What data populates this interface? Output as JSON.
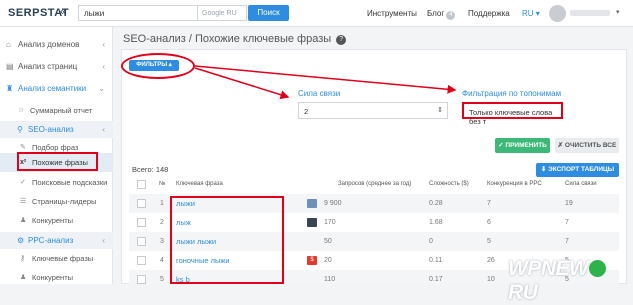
{
  "header": {
    "logo": "SERPSTAT",
    "collapse_glyph": "«",
    "search_value": "лыжи",
    "region": "Google RU",
    "search_button": "Поиск",
    "nav": [
      {
        "label": "Инструменты"
      },
      {
        "label": "Блог",
        "badge": "4"
      },
      {
        "label": "Поддержка"
      }
    ],
    "lang": "RU",
    "caret": "▾"
  },
  "sidebar": {
    "items": [
      {
        "label": "Анализ доменов",
        "icon": "⌂"
      },
      {
        "label": "Анализ страниц",
        "icon": "▤"
      },
      {
        "label": "Анализ семантики",
        "icon": "♜"
      }
    ],
    "summary": "Суммарный отчет",
    "seo_group": "SEO-анализ",
    "seo_items": [
      "Подбор фраз",
      "Похожие фразы",
      "Поисковые подсказки",
      "Страницы-лидеры",
      "Конкуренты"
    ],
    "ppc_group": "PPC-анализ",
    "ppc_items": [
      "Ключевые фразы",
      "Конкуренты"
    ]
  },
  "page": {
    "title": "SEO-анализ / Похожие ключевые фразы",
    "help": "?",
    "filters_button": "ФИЛЬТРЫ ▴",
    "strength_label": "Сила связи",
    "strength_value": "2",
    "topic_label": "Фильтрация по топонимам",
    "topic_value": "Только ключевые слова без т",
    "apply_button": "✓ ПРИМЕНИТЬ",
    "clear_button": "✗ ОЧИСТИТЬ ВСЕ",
    "export_button": "⬇ ЭКСПОРТ ТАБЛИЦЫ",
    "total": "Всего: 148"
  },
  "table": {
    "headers": [
      "№",
      "Ключевая фраза",
      "Запросов (среднее за год)",
      "Сложность ($)",
      "Конкуренция в PPC",
      "Сила связи"
    ],
    "rows": [
      {
        "n": "1",
        "kw": "лыжи",
        "icon": "blue",
        "queries": "9 900",
        "difficulty": "0.28",
        "ppc": "7",
        "strength": "19"
      },
      {
        "n": "2",
        "kw": "лыж",
        "icon": "dark",
        "queries": "170",
        "difficulty": "1.68",
        "ppc": "6",
        "strength": "7"
      },
      {
        "n": "3",
        "kw": "лыжи лыжи",
        "icon": "none",
        "queries": "50",
        "difficulty": "0",
        "ppc": "5",
        "strength": "7"
      },
      {
        "n": "4",
        "kw": "гоночные лыжи",
        "icon": "red",
        "queries": "20",
        "difficulty": "0.11",
        "ppc": "26",
        "strength": "5"
      },
      {
        "n": "5",
        "kw": "ks b",
        "icon": "none",
        "queries": "110",
        "difficulty": "0.17",
        "ppc": "10",
        "strength": "5"
      }
    ]
  },
  "watermark": {
    "left": "WPNEW",
    "right": "RU"
  },
  "colors": {
    "accent": "#2e8de0",
    "highlight": "#e0001b",
    "apply": "#3cb878"
  }
}
